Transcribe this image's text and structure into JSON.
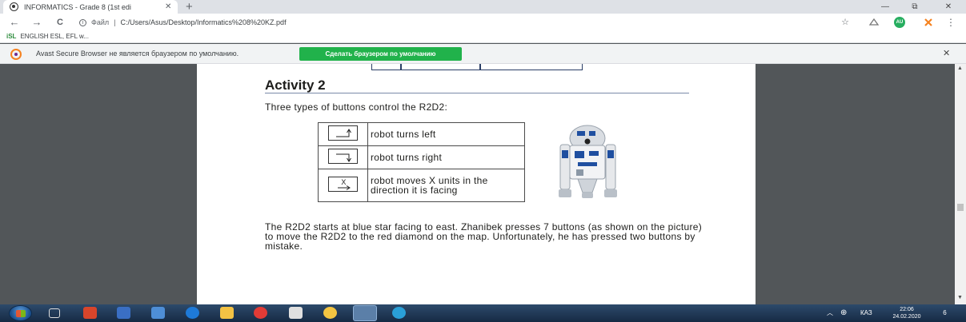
{
  "browser": {
    "tab_title": "INFORMATICS - Grade 8 (1st edi",
    "tab_close": "✕",
    "new_tab": "+",
    "window_controls": [
      "—",
      "⧉",
      "✕"
    ],
    "back": "←",
    "forward": "→",
    "reload": "C",
    "address_scheme_label": "Файл",
    "address_separator": "|",
    "address_url": "C:/Users/Asus/Desktop/Informatics%208%20KZ.pdf",
    "profile_initials": "AU",
    "menu": "⋮",
    "bookmark_badge": "iSL",
    "bookmark_label": "ENGLISH ESL, EFL w...",
    "infobar_message": "Avast Secure Browser не является браузером по умолчанию.",
    "infobar_button": "Сделать браузером по умолчанию",
    "infobar_close": "✕"
  },
  "pdf": {
    "heading": "Activity 2",
    "intro": "Three types of buttons control the R2D2:",
    "buttons": [
      {
        "icon": "turn-left-key",
        "text": "robot turns left"
      },
      {
        "icon": "turn-right-key",
        "text": "robot turns right"
      },
      {
        "icon": "move-x-key",
        "key_label": "X",
        "text": "robot moves X units in the direction it is facing"
      }
    ],
    "paragraph": "The R2D2 starts at blue star facing to east. Zhanibek presses 7 buttons (as shown on the picture) to move the R2D2 to the red diamond on the map. Unfortunately, he has pressed two buttons by mistake."
  },
  "taskbar": {
    "language": "КАЗ",
    "time": "22:06",
    "date": "24.02.2020",
    "notification_count": "6"
  },
  "colors": {
    "page_bg": "#525659",
    "infobar_button": "#21b24b",
    "taskbar": "#1c3350",
    "avast_orange": "#f58220"
  }
}
